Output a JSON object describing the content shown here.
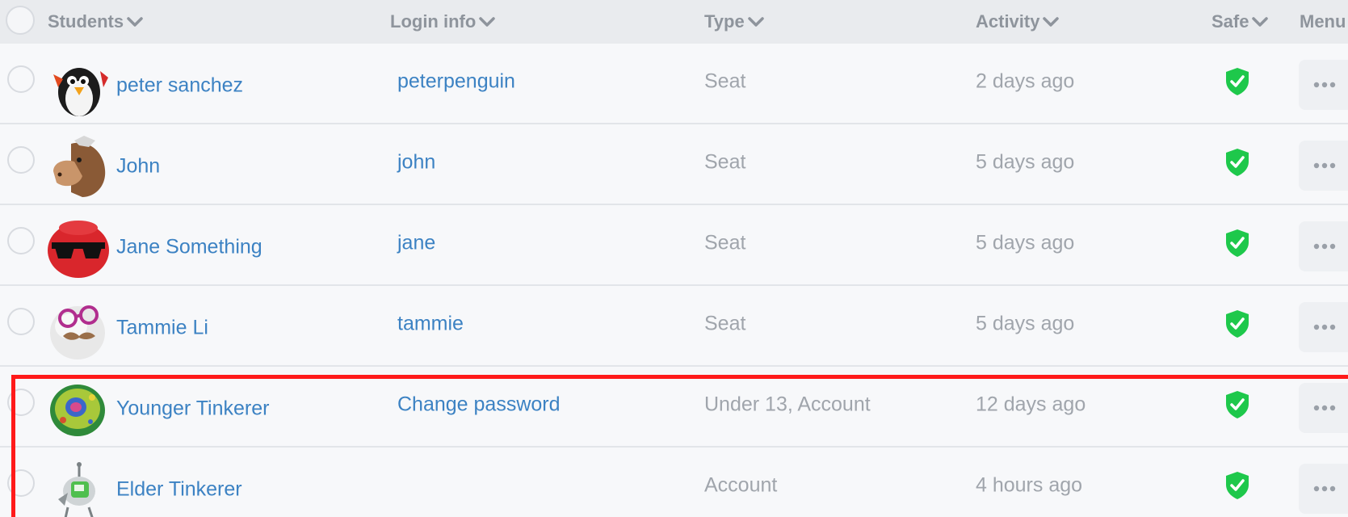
{
  "header": {
    "students": "Students",
    "login_info": "Login info",
    "type": "Type",
    "activity": "Activity",
    "safe": "Safe",
    "menu": "Menu"
  },
  "rows": [
    {
      "name": "peter sanchez",
      "login": "peterpenguin",
      "type": "Seat",
      "activity": "2 days ago",
      "avatar": "penguin-avatar"
    },
    {
      "name": "John",
      "login": "john",
      "type": "Seat",
      "activity": "5 days ago",
      "avatar": "horse-avatar"
    },
    {
      "name": "Jane Something",
      "login": "jane",
      "type": "Seat",
      "activity": "5 days ago",
      "avatar": "red-sunglasses-avatar"
    },
    {
      "name": "Tammie Li",
      "login": "tammie",
      "type": "Seat",
      "activity": "5 days ago",
      "avatar": "egg-glasses-avatar"
    },
    {
      "name": "Younger Tinkerer",
      "login": "Change password",
      "type": "Under 13, Account",
      "activity": "12 days ago",
      "avatar": "cell-avatar"
    },
    {
      "name": "Elder Tinkerer",
      "login": "",
      "type": "Account",
      "activity": "4 hours ago",
      "avatar": "robot-avatar"
    }
  ],
  "colors": {
    "link": "#3c82c3",
    "muted": "#a0a5ac",
    "safe_green": "#1ec84b",
    "highlight": "#ff1a1a"
  }
}
